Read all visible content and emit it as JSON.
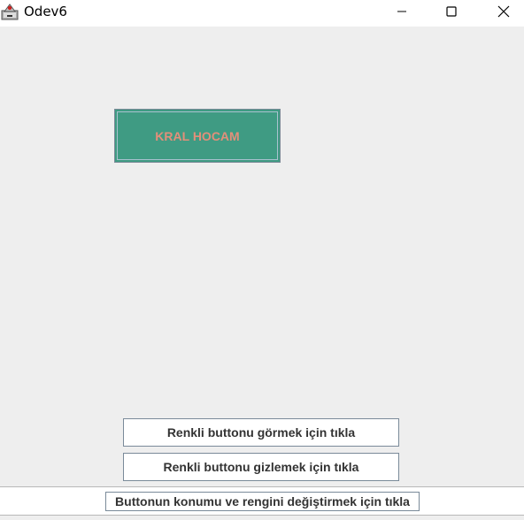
{
  "window": {
    "title": "Odev6",
    "icon": "java-app-icon",
    "controls": [
      "minimize-icon",
      "maximize-icon",
      "close-icon"
    ]
  },
  "colored_button": {
    "label": "KRAL HOCAM",
    "background_color": "#3f9b83",
    "text_color": "#e38f7a"
  },
  "buttons": {
    "show": "Renkli buttonu görmek için tıkla",
    "hide": "Renkli buttonu gizlemek için tıkla",
    "move": "Buttonun konumu ve rengini değiştirmek için tıkla"
  },
  "colors": {
    "window_background": "#eeeeee",
    "titlebar": "#ffffff"
  }
}
